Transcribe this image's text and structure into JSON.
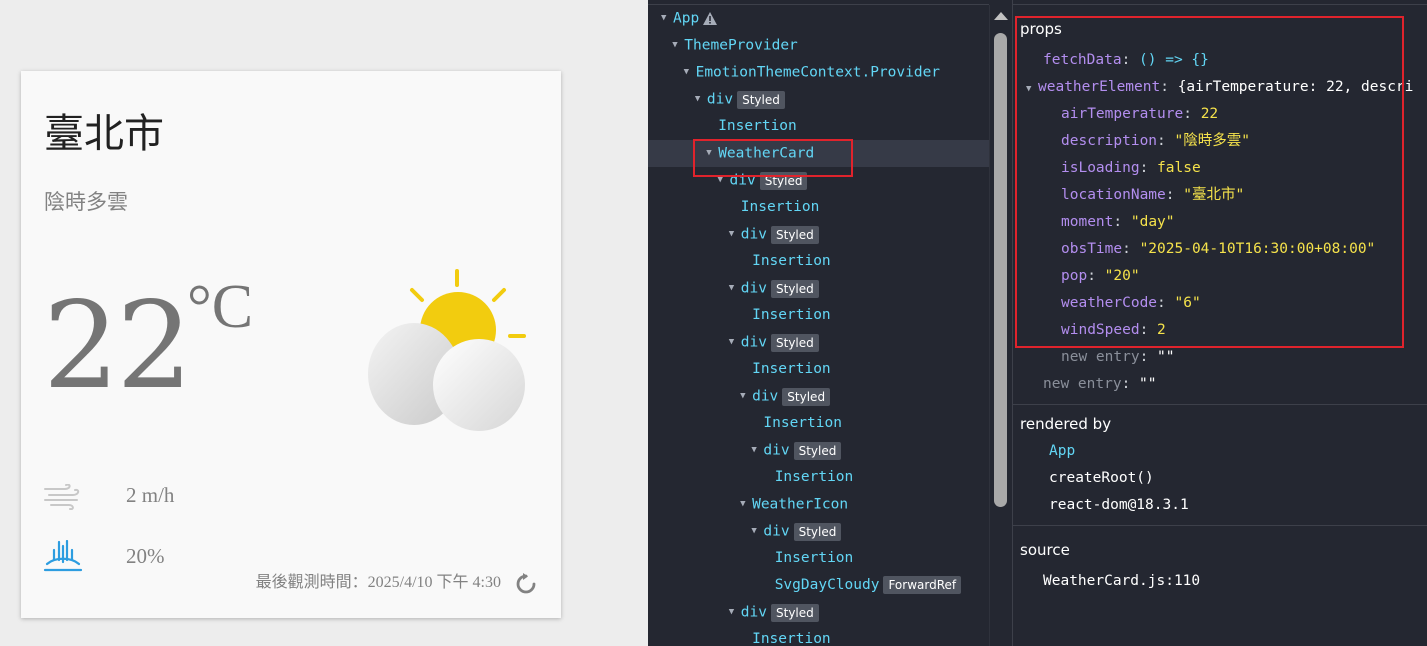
{
  "weather_card": {
    "location_name": "臺北市",
    "description": "陰時多雲",
    "temperature": "22",
    "unit": "°C",
    "wind_speed": "2 m/h",
    "rain_probability": "20%",
    "last_observation": "最後觀測時間：2025/4/10 下午 4:30",
    "colors": {
      "sun": "#f2cc0f",
      "wind_icon": "#c8c8c8",
      "rain_icon": "#2d9de0"
    }
  },
  "component_tree": {
    "rows": [
      {
        "label": "App",
        "indent": 0,
        "arrow": true,
        "warning": true
      },
      {
        "label": "ThemeProvider",
        "indent": 1,
        "arrow": true
      },
      {
        "label": "EmotionThemeContext.Provider",
        "indent": 2,
        "arrow": true
      },
      {
        "label": "div",
        "indent": 3,
        "arrow": true,
        "badge": "Styled"
      },
      {
        "label": "Insertion",
        "indent": 4
      },
      {
        "label": "WeatherCard",
        "indent": 4,
        "arrow": true,
        "selected": true
      },
      {
        "label": "div",
        "indent": 5,
        "arrow": true,
        "badge": "Styled"
      },
      {
        "label": "Insertion",
        "indent": 6
      },
      {
        "label": "div",
        "indent": 6,
        "arrow": true,
        "badge": "Styled"
      },
      {
        "label": "Insertion",
        "indent": 7
      },
      {
        "label": "div",
        "indent": 6,
        "arrow": true,
        "badge": "Styled"
      },
      {
        "label": "Insertion",
        "indent": 7
      },
      {
        "label": "div",
        "indent": 6,
        "arrow": true,
        "badge": "Styled"
      },
      {
        "label": "Insertion",
        "indent": 7
      },
      {
        "label": "div",
        "indent": 7,
        "arrow": true,
        "badge": "Styled"
      },
      {
        "label": "Insertion",
        "indent": 8
      },
      {
        "label": "div",
        "indent": 8,
        "arrow": true,
        "badge": "Styled"
      },
      {
        "label": "Insertion",
        "indent": 9
      },
      {
        "label": "WeatherIcon",
        "indent": 7,
        "arrow": true
      },
      {
        "label": "div",
        "indent": 8,
        "arrow": true,
        "badge": "Styled"
      },
      {
        "label": "Insertion",
        "indent": 9
      },
      {
        "label": "SvgDayCloudy",
        "indent": 9,
        "badge": "ForwardRef"
      },
      {
        "label": "div",
        "indent": 6,
        "arrow": true,
        "badge": "Styled"
      },
      {
        "label": "Insertion",
        "indent": 7
      }
    ]
  },
  "props_panel": {
    "title": "props",
    "fetch_data_key": "fetchData",
    "fetch_data_value": "() => {}",
    "weather_element_key": "weatherElement",
    "weather_element_summary": "{airTemperature: 22, descri",
    "fields": [
      {
        "key": "airTemperature",
        "value": "22",
        "type": "num"
      },
      {
        "key": "description",
        "value": "\"陰時多雲\"",
        "type": "str"
      },
      {
        "key": "isLoading",
        "value": "false",
        "type": "num"
      },
      {
        "key": "locationName",
        "value": "\"臺北市\"",
        "type": "str"
      },
      {
        "key": "moment",
        "value": "\"day\"",
        "type": "str"
      },
      {
        "key": "obsTime",
        "value": "\"2025-04-10T16:30:00+08:00\"",
        "type": "str"
      },
      {
        "key": "pop",
        "value": "\"20\"",
        "type": "str"
      },
      {
        "key": "weatherCode",
        "value": "\"6\"",
        "type": "str"
      },
      {
        "key": "windSpeed",
        "value": "2",
        "type": "num"
      }
    ],
    "new_entry_inner_key": "new entry",
    "new_entry_inner_value": "\"\"",
    "new_entry_outer_key": "new entry",
    "new_entry_outer_value": "\"\"",
    "rendered_by_title": "rendered by",
    "rendered_by": [
      "App",
      "createRoot()",
      "react-dom@18.3.1"
    ],
    "source_title": "source",
    "source_value": "WeatherCard.js:110"
  }
}
